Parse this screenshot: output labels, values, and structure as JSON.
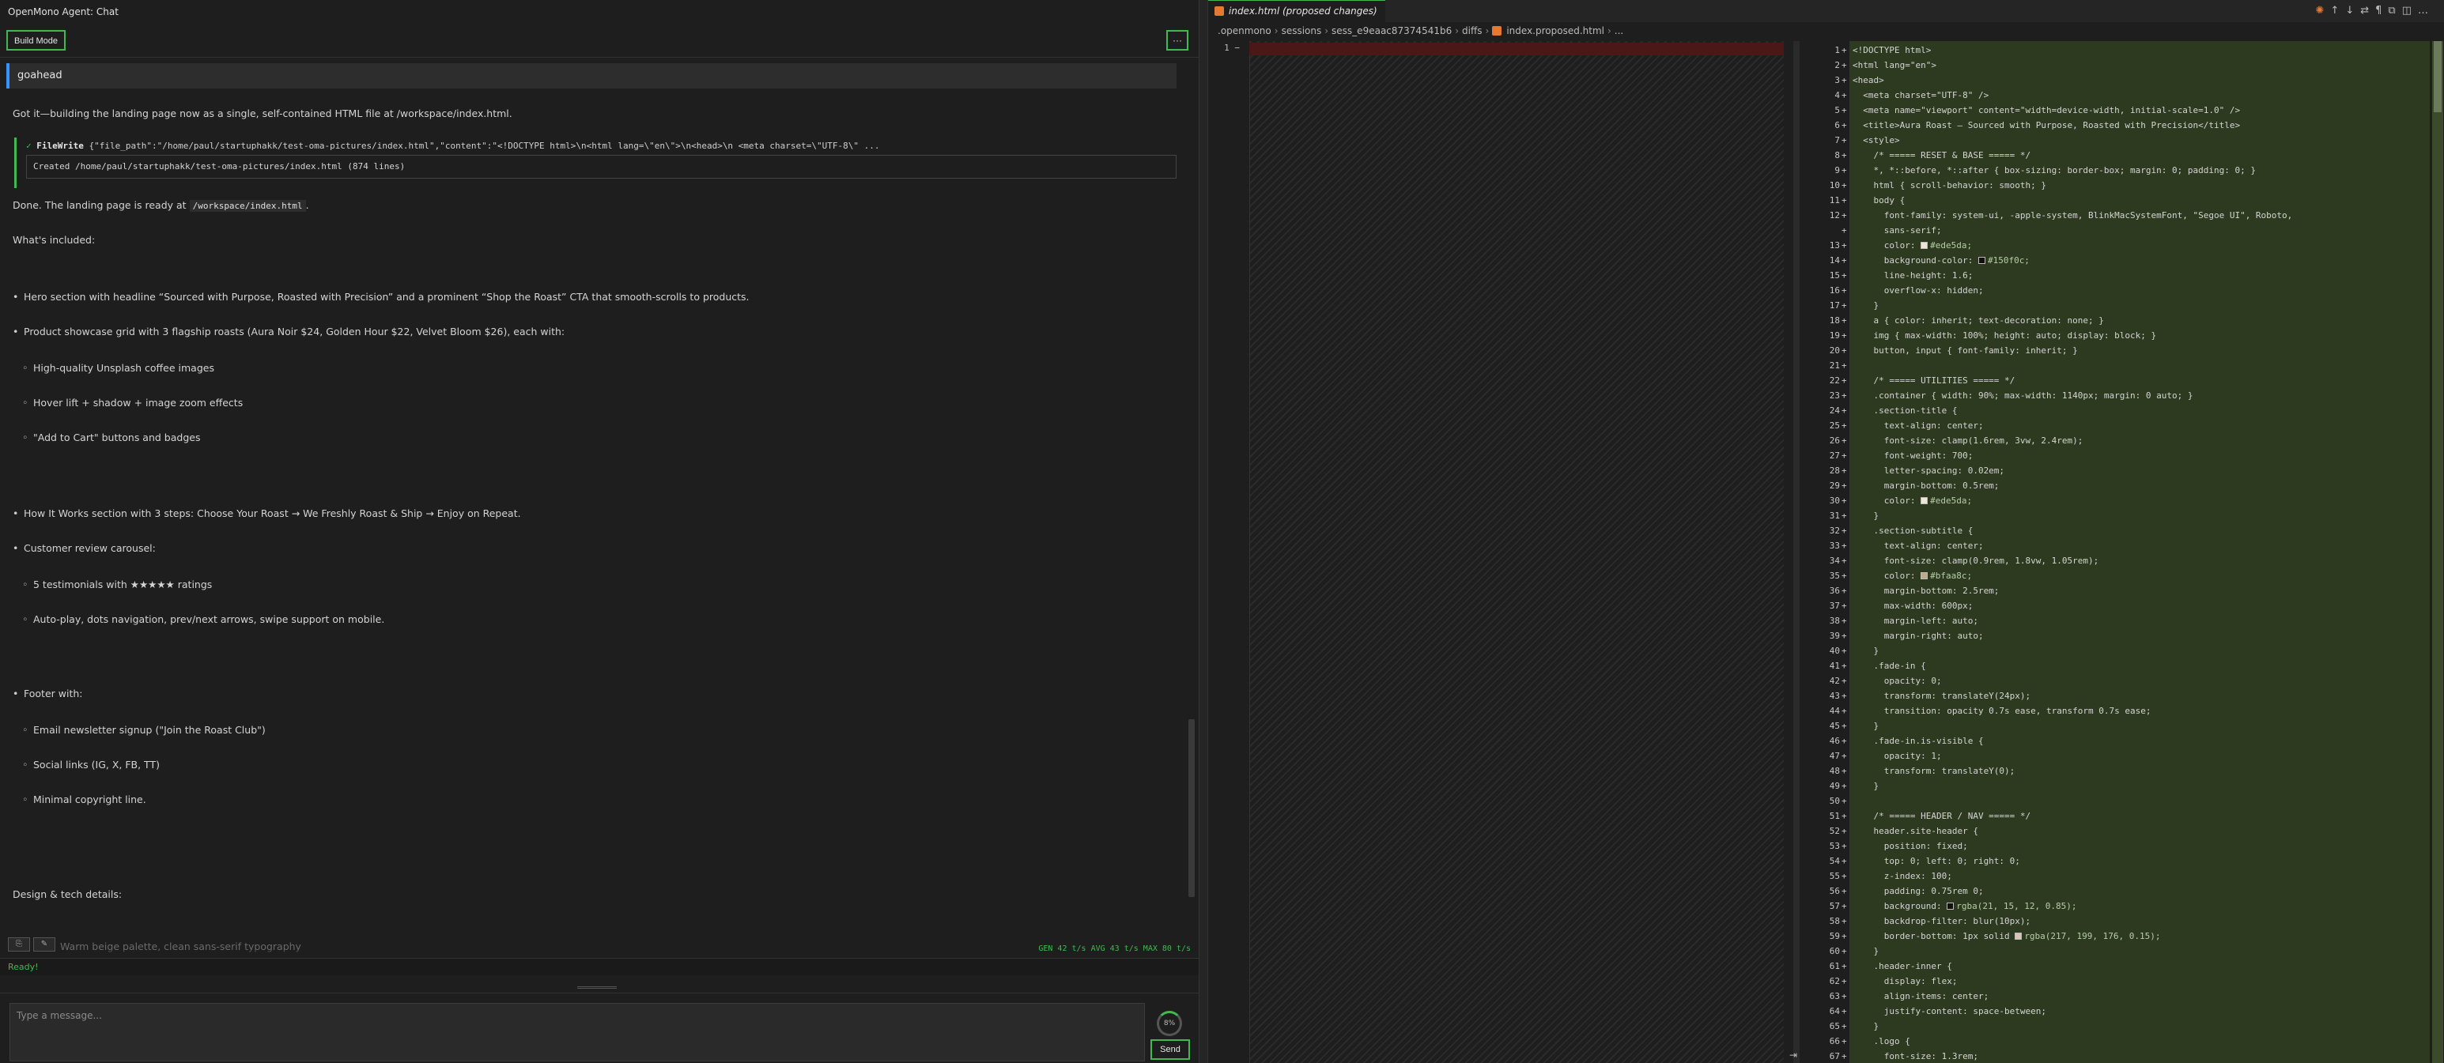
{
  "chat": {
    "title": "OpenMono Agent: Chat",
    "build_mode": "Build Mode",
    "more": "···",
    "user_message": "goahead",
    "intro": "Got it—building the landing page now as a single, self-contained HTML file at /workspace/index.html.",
    "tool": {
      "name": "FileWrite",
      "args": "{\"file_path\":\"/home/paul/startuphakk/test-oma-pictures/index.html\",\"content\":\"<!DOCTYPE html>\\n<html lang=\\\"en\\\">\\n<head>\\n  <meta charset=\\\"UTF-8\\\" ...",
      "output": "Created /home/paul/startuphakk/test-oma-pictures/index.html (874 lines)"
    },
    "done_prefix": "Done. The landing page is ready at",
    "done_path": "/workspace/index.html",
    "done_suffix": ".",
    "included": "What's included:",
    "bullets": {
      "hero": "Hero section with headline “Sourced with Purpose, Roasted with Precision” and a prominent “Shop the Roast” CTA that smooth-scrolls to products.",
      "product": "Product showcase grid with 3 flagship roasts (Aura Noir $24, Golden Hour $22, Velvet Bloom $26), each with:",
      "product_sub": [
        "High-quality Unsplash coffee images",
        "Hover lift + shadow + image zoom effects",
        "\"Add to Cart\" buttons and badges"
      ],
      "how": "How It Works section with 3 steps: Choose Your Roast → We Freshly Roast & Ship → Enjoy on Repeat.",
      "reviews": "Customer review carousel:",
      "reviews_sub": [
        "5 testimonials with ★★★★★ ratings",
        "Auto-play, dots navigation, prev/next arrows, swipe support on mobile."
      ],
      "footer": "Footer with:",
      "footer_sub": [
        "Email newsletter signup (\"Join the Roast Club\")",
        "Social links (IG, X, FB, TT)",
        "Minimal copyright line."
      ]
    },
    "design": "Design & tech details:",
    "faded": "Warm beige palette, clean sans-serif typography",
    "stats": "GEN 42 t/s AVG 43 t/s MAX 80 t/s",
    "status": "Ready!",
    "input_placeholder": "Type a message...",
    "context_pct": "8%",
    "send": "Send"
  },
  "editor": {
    "tab_label": "index.html (proposed changes)",
    "breadcrumb": [
      ".openmono",
      "sessions",
      "sess_e9eaac87374541b6",
      "diffs",
      "index.proposed.html",
      "..."
    ],
    "left_line": "1",
    "left_marker": "−",
    "colors": {
      "accent": "#3fb950",
      "added_bg": "#2d3a1f",
      "removed_bg": "#4b1818"
    },
    "lines": [
      {
        "n": "1",
        "t": "<!DOCTYPE html>",
        "k": "tag"
      },
      {
        "n": "2",
        "t": "<html lang=\"en\">",
        "k": "tag"
      },
      {
        "n": "3",
        "t": "<head>",
        "k": "tag"
      },
      {
        "n": "4",
        "t": "  <meta charset=\"UTF-8\" />",
        "k": "tag"
      },
      {
        "n": "5",
        "t": "  <meta name=\"viewport\" content=\"width=device-width, initial-scale=1.0\" />",
        "k": "tag"
      },
      {
        "n": "6",
        "t": "  <title>Aura Roast — Sourced with Purpose, Roasted with Precision</title>",
        "k": "tag"
      },
      {
        "n": "7",
        "t": "  <style>",
        "k": "tag"
      },
      {
        "n": "8",
        "t": "    /* ===== RESET & BASE ===== */",
        "k": "com"
      },
      {
        "n": "9",
        "t": "    *, *::before, *::after { box-sizing: border-box; margin: 0; padding: 0; }",
        "k": "sel"
      },
      {
        "n": "10",
        "t": "    html { scroll-behavior: smooth; }",
        "k": "sel"
      },
      {
        "n": "11",
        "t": "    body {",
        "k": "sel"
      },
      {
        "n": "12",
        "t": "      font-family: system-ui, -apple-system, BlinkMacSystemFont, \"Segoe UI\", Roboto,",
        "k": "prop"
      },
      {
        "n": "",
        "t": "      sans-serif;",
        "k": "prop"
      },
      {
        "n": "13",
        "t": "      color: #ede5da;",
        "k": "prop",
        "sw": "#ede5da"
      },
      {
        "n": "14",
        "t": "      background-color: #150f0c;",
        "k": "prop",
        "sw": "#150f0c"
      },
      {
        "n": "15",
        "t": "      line-height: 1.6;",
        "k": "prop"
      },
      {
        "n": "16",
        "t": "      overflow-x: hidden;",
        "k": "prop"
      },
      {
        "n": "17",
        "t": "    }",
        "k": "plain"
      },
      {
        "n": "18",
        "t": "    a { color: inherit; text-decoration: none; }",
        "k": "sel"
      },
      {
        "n": "19",
        "t": "    img { max-width: 100%; height: auto; display: block; }",
        "k": "sel"
      },
      {
        "n": "20",
        "t": "    button, input { font-family: inherit; }",
        "k": "sel"
      },
      {
        "n": "21",
        "t": "",
        "k": "plain"
      },
      {
        "n": "22",
        "t": "    /* ===== UTILITIES ===== */",
        "k": "com"
      },
      {
        "n": "23",
        "t": "    .container { width: 90%; max-width: 1140px; margin: 0 auto; }",
        "k": "sel"
      },
      {
        "n": "24",
        "t": "    .section-title {",
        "k": "sel"
      },
      {
        "n": "25",
        "t": "      text-align: center;",
        "k": "prop"
      },
      {
        "n": "26",
        "t": "      font-size: clamp(1.6rem, 3vw, 2.4rem);",
        "k": "prop"
      },
      {
        "n": "27",
        "t": "      font-weight: 700;",
        "k": "prop"
      },
      {
        "n": "28",
        "t": "      letter-spacing: 0.02em;",
        "k": "prop"
      },
      {
        "n": "29",
        "t": "      margin-bottom: 0.5rem;",
        "k": "prop"
      },
      {
        "n": "30",
        "t": "      color: #ede5da;",
        "k": "prop",
        "sw": "#ede5da"
      },
      {
        "n": "31",
        "t": "    }",
        "k": "plain"
      },
      {
        "n": "32",
        "t": "    .section-subtitle {",
        "k": "sel"
      },
      {
        "n": "33",
        "t": "      text-align: center;",
        "k": "prop"
      },
      {
        "n": "34",
        "t": "      font-size: clamp(0.9rem, 1.8vw, 1.05rem);",
        "k": "prop"
      },
      {
        "n": "35",
        "t": "      color: #bfaa8c;",
        "k": "prop",
        "sw": "#bfaa8c"
      },
      {
        "n": "36",
        "t": "      margin-bottom: 2.5rem;",
        "k": "prop"
      },
      {
        "n": "37",
        "t": "      max-width: 600px;",
        "k": "prop"
      },
      {
        "n": "38",
        "t": "      margin-left: auto;",
        "k": "prop"
      },
      {
        "n": "39",
        "t": "      margin-right: auto;",
        "k": "prop"
      },
      {
        "n": "40",
        "t": "    }",
        "k": "plain"
      },
      {
        "n": "41",
        "t": "    .fade-in {",
        "k": "sel"
      },
      {
        "n": "42",
        "t": "      opacity: 0;",
        "k": "prop"
      },
      {
        "n": "43",
        "t": "      transform: translateY(24px);",
        "k": "prop"
      },
      {
        "n": "44",
        "t": "      transition: opacity 0.7s ease, transform 0.7s ease;",
        "k": "prop"
      },
      {
        "n": "45",
        "t": "    }",
        "k": "plain"
      },
      {
        "n": "46",
        "t": "    .fade-in.is-visible {",
        "k": "sel"
      },
      {
        "n": "47",
        "t": "      opacity: 1;",
        "k": "prop"
      },
      {
        "n": "48",
        "t": "      transform: translateY(0);",
        "k": "prop"
      },
      {
        "n": "49",
        "t": "    }",
        "k": "plain"
      },
      {
        "n": "50",
        "t": "",
        "k": "plain"
      },
      {
        "n": "51",
        "t": "    /* ===== HEADER / NAV ===== */",
        "k": "com"
      },
      {
        "n": "52",
        "t": "    header.site-header {",
        "k": "sel"
      },
      {
        "n": "53",
        "t": "      position: fixed;",
        "k": "prop"
      },
      {
        "n": "54",
        "t": "      top: 0; left: 0; right: 0;",
        "k": "prop"
      },
      {
        "n": "55",
        "t": "      z-index: 100;",
        "k": "prop"
      },
      {
        "n": "56",
        "t": "      padding: 0.75rem 0;",
        "k": "prop"
      },
      {
        "n": "57",
        "t": "      background: rgba(21, 15, 12, 0.85);",
        "k": "prop",
        "sw": "#150f0c"
      },
      {
        "n": "58",
        "t": "      backdrop-filter: blur(10px);",
        "k": "prop"
      },
      {
        "n": "59",
        "t": "      border-bottom: 1px solid rgba(217, 199, 176, 0.15);",
        "k": "prop",
        "sw": "#d9c7b0"
      },
      {
        "n": "60",
        "t": "    }",
        "k": "plain"
      },
      {
        "n": "61",
        "t": "    .header-inner {",
        "k": "sel"
      },
      {
        "n": "62",
        "t": "      display: flex;",
        "k": "prop"
      },
      {
        "n": "63",
        "t": "      align-items: center;",
        "k": "prop"
      },
      {
        "n": "64",
        "t": "      justify-content: space-between;",
        "k": "prop"
      },
      {
        "n": "65",
        "t": "    }",
        "k": "plain"
      },
      {
        "n": "66",
        "t": "    .logo {",
        "k": "sel"
      },
      {
        "n": "67",
        "t": "      font-size: 1.3rem;",
        "k": "prop"
      }
    ]
  }
}
